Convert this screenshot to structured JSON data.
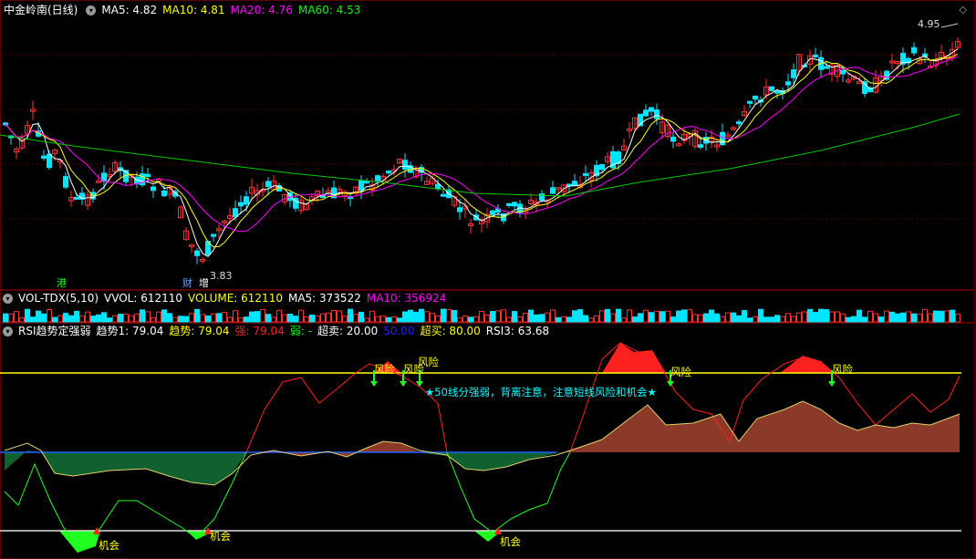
{
  "main_panel": {
    "title": "中金岭南(日线)",
    "indicators": [
      {
        "label": "MA5: 4.82",
        "color": "#ffffff"
      },
      {
        "label": "MA10: 4.81",
        "color": "#ffff00"
      },
      {
        "label": "MA20: 4.76",
        "color": "#ff00ff"
      },
      {
        "label": "MA60: 4.53",
        "color": "#00ff00"
      }
    ],
    "high_label": "4.95",
    "low_label": "3.83",
    "markers": [
      {
        "text": "港",
        "color": "#00ff00"
      },
      {
        "text": "财",
        "color": "#6fa8ff"
      },
      {
        "text": "增",
        "color": "#ffffff"
      }
    ]
  },
  "volume_panel": {
    "title": "VOL-TDX(5,10)",
    "indicators": [
      {
        "label": "VVOL: 612110",
        "color": "#ffffff"
      },
      {
        "label": "VOLUME: 612110",
        "color": "#ffff00"
      },
      {
        "label": "MA5: 373522",
        "color": "#ffffff"
      },
      {
        "label": "MA10: 356924",
        "color": "#ff00ff"
      }
    ]
  },
  "rsi_panel": {
    "title": "RSI趋势定强弱",
    "indicators": [
      {
        "label": "趋势1: 79.04",
        "color": "#ffffff"
      },
      {
        "label": "趋势: 79.04",
        "color": "#ffff00"
      },
      {
        "label": "强: 79.04",
        "color": "#ff2020"
      },
      {
        "label": "弱: -",
        "color": "#00ff00"
      },
      {
        "label": "超卖: 20.00",
        "color": "#ffffff"
      },
      {
        "label": "50.00",
        "color": "#2020ff"
      },
      {
        "label": "超买: 80.00",
        "color": "#ffff00"
      },
      {
        "label": "RSI3: 63.68",
        "color": "#ffffff"
      }
    ],
    "risk_label": "风险",
    "chance_label": "机会",
    "note": "★50线分强弱，背离注意，注意短线风险和机会★"
  },
  "colors": {
    "up": "#ff3030",
    "down": "#00e5ff",
    "grid": "#5a0000",
    "ma5": "#ffffff",
    "ma10": "#ffff00",
    "ma20": "#ff00ff",
    "ma60": "#00cc00"
  },
  "icons": {
    "settings": "diamond-icon",
    "panel": "chevron-down-icon"
  }
}
